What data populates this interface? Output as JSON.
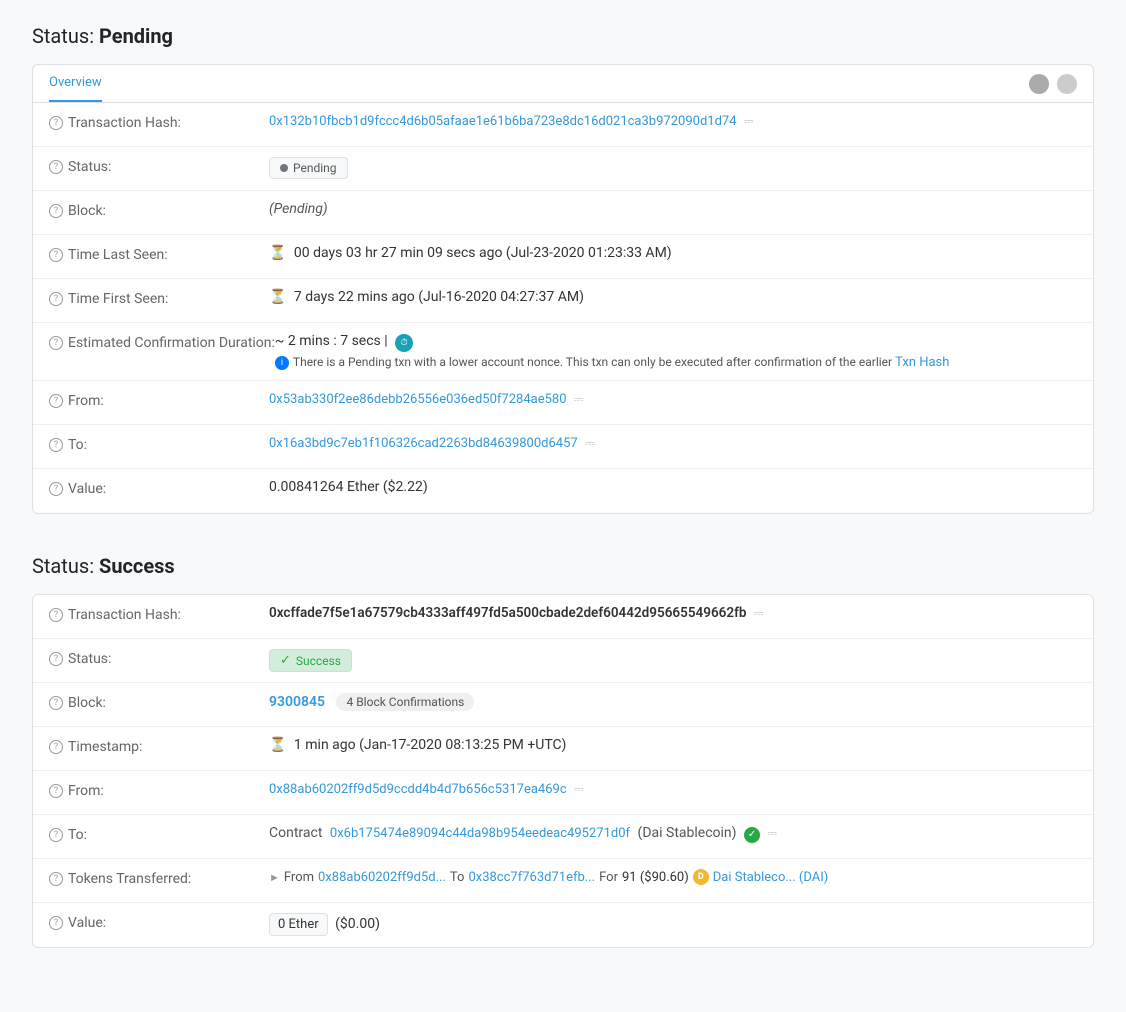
{
  "pending": {
    "section_title": "Status:",
    "section_status": "Pending",
    "tab_label": "Overview",
    "rows": {
      "tx_hash_label": "Transaction Hash:",
      "tx_hash_value": "0x132b10fbcb1d9fccc4d6b05afaae1e61b6ba723e8dc16d021ca3b972090d1d74",
      "status_label": "Status:",
      "status_value": "Pending",
      "block_label": "Block:",
      "block_value": "(Pending)",
      "time_last_seen_label": "Time Last Seen:",
      "time_last_seen_value": "00 days 03 hr 27 min 09 secs ago (Jul-23-2020 01:23:33 AM)",
      "time_first_seen_label": "Time First Seen:",
      "time_first_seen_value": "7 days 22 mins ago (Jul-16-2020 04:27:37 AM)",
      "est_confirm_label": "Estimated Confirmation Duration:",
      "est_confirm_value": "~ 2 mins : 7 secs |",
      "est_confirm_warning": "There is a Pending txn with a lower account nonce. This txn can only be executed after confirmation of the earlier",
      "txn_hash_link_text": "Txn Hash",
      "from_label": "From:",
      "from_value": "0x53ab330f2ee86debb26556e036ed50f7284ae580",
      "to_label": "To:",
      "to_value": "0x16a3bd9c7eb1f106326cad2263bd84639800d6457",
      "value_label": "Value:",
      "value_value": "0.00841264 Ether ($2.22)"
    }
  },
  "success": {
    "section_title": "Status:",
    "section_status": "Success",
    "rows": {
      "tx_hash_label": "Transaction Hash:",
      "tx_hash_value": "0xcffade7f5e1a67579cb4333aff497fd5a500cbade2def60442d95665549662fb",
      "status_label": "Status:",
      "status_value": "Success",
      "block_label": "Block:",
      "block_number": "9300845",
      "block_confirmations": "4 Block Confirmations",
      "timestamp_label": "Timestamp:",
      "timestamp_value": "1 min ago (Jan-17-2020 08:13:25 PM +UTC)",
      "from_label": "From:",
      "from_value": "0x88ab60202ff9d5d9ccdd4b4d7b656c5317ea469c",
      "to_label": "To:",
      "to_contract_label": "Contract",
      "to_contract_address": "0x6b175474e89094c44da98b954eedeac495271d0f",
      "to_contract_name": "(Dai Stablecoin)",
      "tokens_transferred_label": "Tokens Transferred:",
      "tokens_from": "0x88ab60202ff9d5d...",
      "tokens_to": "0x38cc7f763d71efb...",
      "tokens_amount": "91 ($90.60)",
      "tokens_name": "Dai Stableco... (DAI)",
      "value_label": "Value:",
      "value_ether": "0 Ether",
      "value_usd": "($0.00)"
    }
  }
}
